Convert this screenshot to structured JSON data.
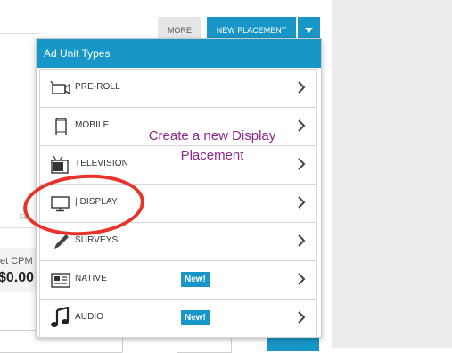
{
  "background": {
    "tab_fragment": "Fe",
    "cpm_label": "et CPM",
    "cpm_value": "$0.00"
  },
  "toolbar": {
    "more_label": "MORE",
    "new_placement_label": "NEW PLACEMENT",
    "caret_icon": "chevron-down-icon"
  },
  "dropdown": {
    "title": "Ad Unit Types",
    "items": [
      {
        "label": "PRE-ROLL",
        "icon": "video-camera-icon",
        "badge": ""
      },
      {
        "label": "MOBILE",
        "icon": "mobile-phone-icon",
        "badge": ""
      },
      {
        "label": "TELEVISION",
        "icon": "television-icon",
        "badge": ""
      },
      {
        "label": "| DISPLAY",
        "icon": "monitor-icon",
        "badge": ""
      },
      {
        "label": "SURVEYS",
        "icon": "pencil-icon",
        "badge": ""
      },
      {
        "label": "NATIVE",
        "icon": "newspaper-icon",
        "badge": "New!"
      },
      {
        "label": "AUDIO",
        "icon": "music-note-icon",
        "badge": "New!"
      }
    ]
  },
  "annotation": {
    "text_line1": "Create a new Display",
    "text_line2": "Placement",
    "circle_color": "#e8332a",
    "text_color": "#8c278c"
  },
  "colors": {
    "accent": "#1796c8"
  }
}
